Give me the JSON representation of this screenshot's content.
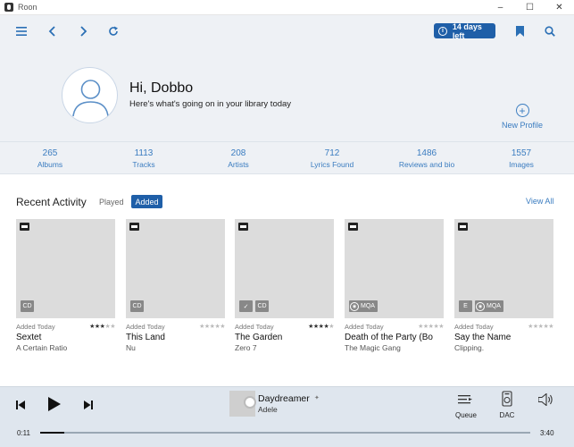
{
  "window": {
    "title": "Roon",
    "controls": [
      "–",
      "☐",
      "✕"
    ]
  },
  "toolbar": {
    "trial_badge": "14 days left",
    "icons": [
      "menu-icon",
      "back-icon",
      "forward-icon",
      "refresh-icon",
      "bookmark-icon",
      "search-icon"
    ]
  },
  "profile": {
    "greeting": "Hi, Dobbo",
    "subtitle": "Here's what's going on in your library today",
    "new_profile": "New Profile"
  },
  "stats": [
    {
      "value": "265",
      "label": "Albums"
    },
    {
      "value": "1113",
      "label": "Tracks"
    },
    {
      "value": "208",
      "label": "Artists"
    },
    {
      "value": "712",
      "label": "Lyrics Found"
    },
    {
      "value": "1486",
      "label": "Reviews and bio"
    },
    {
      "value": "1557",
      "label": "Images"
    }
  ],
  "recent": {
    "title": "Recent Activity",
    "filter_played": "Played",
    "filter_added": "Added",
    "view_all": "View All",
    "albums": [
      {
        "added": "Added Today",
        "title": "Sextet",
        "artist": "A Certain Ratio",
        "rating": 3,
        "badges": [
          "CD"
        ],
        "check": false,
        "mqa": false
      },
      {
        "added": "Added Today",
        "title": "This Land",
        "artist": "Nu",
        "rating": 0,
        "badges": [
          "CD"
        ],
        "check": false,
        "mqa": false
      },
      {
        "added": "Added Today",
        "title": "The Garden",
        "artist": "Zero 7",
        "rating": 4,
        "badges": [
          "✓",
          "CD"
        ],
        "check": true,
        "mqa": false
      },
      {
        "added": "Added Today",
        "title": "Death of the Party (Bo",
        "artist": "The Magic Gang",
        "rating": 0,
        "badges": [],
        "check": false,
        "mqa": true
      },
      {
        "added": "Added Today",
        "title": "Say the Name",
        "artist": "Clipping.",
        "rating": 0,
        "badges": [
          "E"
        ],
        "check": false,
        "mqa": true
      }
    ],
    "mqa_label": "MQA"
  },
  "player": {
    "track_title": "Daydreamer",
    "track_artist": "Adele",
    "queue_label": "Queue",
    "dac_label": "DAC",
    "elapsed": "0:11",
    "duration": "3:40",
    "progress": 0.05
  },
  "colors": {
    "accent": "#1f5fa8",
    "link": "#3a7cc0",
    "panel": "#eef1f5",
    "player": "#dfe6ee"
  }
}
